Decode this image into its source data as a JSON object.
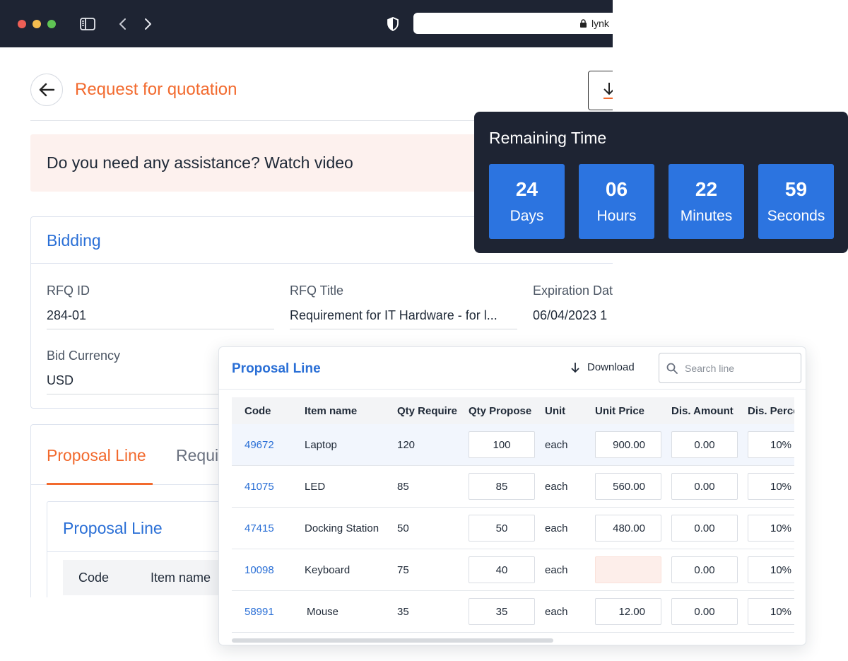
{
  "browser": {
    "url_text": "lynk"
  },
  "header": {
    "title": "Request for quotation"
  },
  "assist": {
    "text": "Do you need any assistance? Watch video"
  },
  "bidding": {
    "title": "Bidding",
    "fields": [
      {
        "label": "RFQ ID",
        "value": "284-01"
      },
      {
        "label": "RFQ Title",
        "value": "Requirement for IT Hardware - for l..."
      },
      {
        "label": "Expiration Dat",
        "value": "06/04/2023 1"
      },
      {
        "label": "Bid Currency",
        "value": "USD"
      }
    ]
  },
  "tabs": {
    "active": "Proposal Line",
    "inactive": "Requi"
  },
  "inner": {
    "title": "Proposal Line",
    "col_code": "Code",
    "col_item": "Item name"
  },
  "timer": {
    "title": "Remaining Time",
    "units": [
      {
        "value": "24",
        "label": "Days"
      },
      {
        "value": "06",
        "label": "Hours"
      },
      {
        "value": "22",
        "label": "Minutes"
      },
      {
        "value": "59",
        "label": "Seconds"
      }
    ]
  },
  "popup": {
    "title": "Proposal Line",
    "download_label": "Download",
    "search_placeholder": "Search line",
    "columns": [
      "Code",
      "Item name",
      "Qty Require",
      "Qty Propose",
      "Unit",
      "Unit Price",
      "Dis. Amount",
      "Dis. Perce"
    ],
    "rows": [
      {
        "code": "49672",
        "item": "Laptop",
        "qty_require": "120",
        "qty_propose": "100",
        "unit": "each",
        "unit_price": "900.00",
        "dis_amount": "0.00",
        "dis_percent": "10%"
      },
      {
        "code": "41075",
        "item": "LED",
        "qty_require": "85",
        "qty_propose": "85",
        "unit": "each",
        "unit_price": "560.00",
        "dis_amount": "0.00",
        "dis_percent": "10%"
      },
      {
        "code": "47415",
        "item": "Docking Station",
        "qty_require": "50",
        "qty_propose": "50",
        "unit": "each",
        "unit_price": "480.00",
        "dis_amount": "0.00",
        "dis_percent": "10%"
      },
      {
        "code": "10098",
        "item": "Keyboard",
        "qty_require": "75",
        "qty_propose": "40",
        "unit": "each",
        "unit_price": "",
        "dis_amount": "0.00",
        "dis_percent": "10%"
      },
      {
        "code": "58991",
        "item": "Mouse",
        "qty_require": "35",
        "qty_propose": "35",
        "unit": "each",
        "unit_price": "12.00",
        "dis_amount": "0.00",
        "dis_percent": "10%"
      }
    ]
  },
  "colors": {
    "accent_orange": "#f26a2e",
    "accent_blue": "#2a6fd6",
    "timer_bg": "#1e2433",
    "timer_box": "#2c74e0",
    "error_fill": "#fdeeea"
  }
}
